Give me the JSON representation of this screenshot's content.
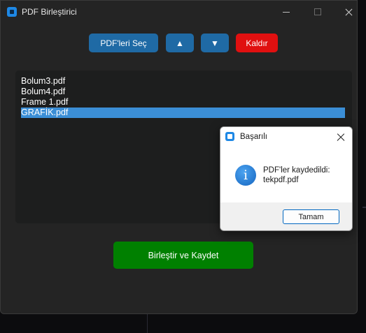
{
  "window": {
    "title": "PDF Birleştirici"
  },
  "toolbar": {
    "select_label": "PDF'leri Seç",
    "up_label": "▲",
    "down_label": "▼",
    "remove_label": "Kaldır"
  },
  "file_list": {
    "items": [
      "Bolum3.pdf",
      "Bolum4.pdf",
      "Frame 1.pdf",
      "GRAFİK.pdf"
    ],
    "selected_index": 3
  },
  "merge_button": {
    "label": "Birleştir ve Kaydet"
  },
  "dialog": {
    "title": "Başarılı",
    "message_line1": "PDF'ler kaydedildi:",
    "message_line2": "tekpdf.pdf",
    "ok_label": "Tamam",
    "icon": "info-icon"
  },
  "colors": {
    "accent_blue": "#1f6aa5",
    "remove_red": "#e01010",
    "merge_green": "#008000",
    "selection": "#3b8ed6"
  }
}
